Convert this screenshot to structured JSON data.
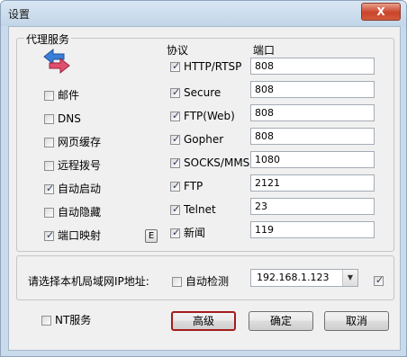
{
  "window": {
    "title": "设置",
    "close_label": "X"
  },
  "proxy_group": {
    "title": "代理服务",
    "protocol_header": "协议",
    "port_header": "端口",
    "left_options": [
      {
        "label": "邮件",
        "checked": false
      },
      {
        "label": "DNS",
        "checked": false
      },
      {
        "label": "网页缓存",
        "checked": false
      },
      {
        "label": "远程拨号",
        "checked": false
      },
      {
        "label": "自动启动",
        "checked": true
      },
      {
        "label": "自动隐藏",
        "checked": false
      },
      {
        "label": "端口映射",
        "checked": true
      }
    ],
    "e_button_label": "E",
    "protocols": [
      {
        "label": "HTTP/RTSP",
        "checked": true,
        "port": "808"
      },
      {
        "label": "Secure",
        "checked": true,
        "port": "808"
      },
      {
        "label": "FTP(Web)",
        "checked": true,
        "port": "808"
      },
      {
        "label": "Gopher",
        "checked": true,
        "port": "808"
      },
      {
        "label": "SOCKS/MMS",
        "checked": true,
        "port": "1080"
      },
      {
        "label": "FTP",
        "checked": true,
        "port": "2121"
      },
      {
        "label": "Telnet",
        "checked": true,
        "port": "23"
      },
      {
        "label": "新闻",
        "checked": true,
        "port": "119"
      }
    ]
  },
  "ip_group": {
    "label": "请选择本机局域网IP地址:",
    "auto_detect_label": "自动检测",
    "auto_detect_checked": false,
    "selected_ip": "192.168.1.123",
    "extra_checked": true
  },
  "footer": {
    "nt_service_label": "NT服务",
    "nt_service_checked": false,
    "advanced_label": "高级",
    "ok_label": "确定",
    "cancel_label": "取消"
  },
  "check_mark": "✓"
}
